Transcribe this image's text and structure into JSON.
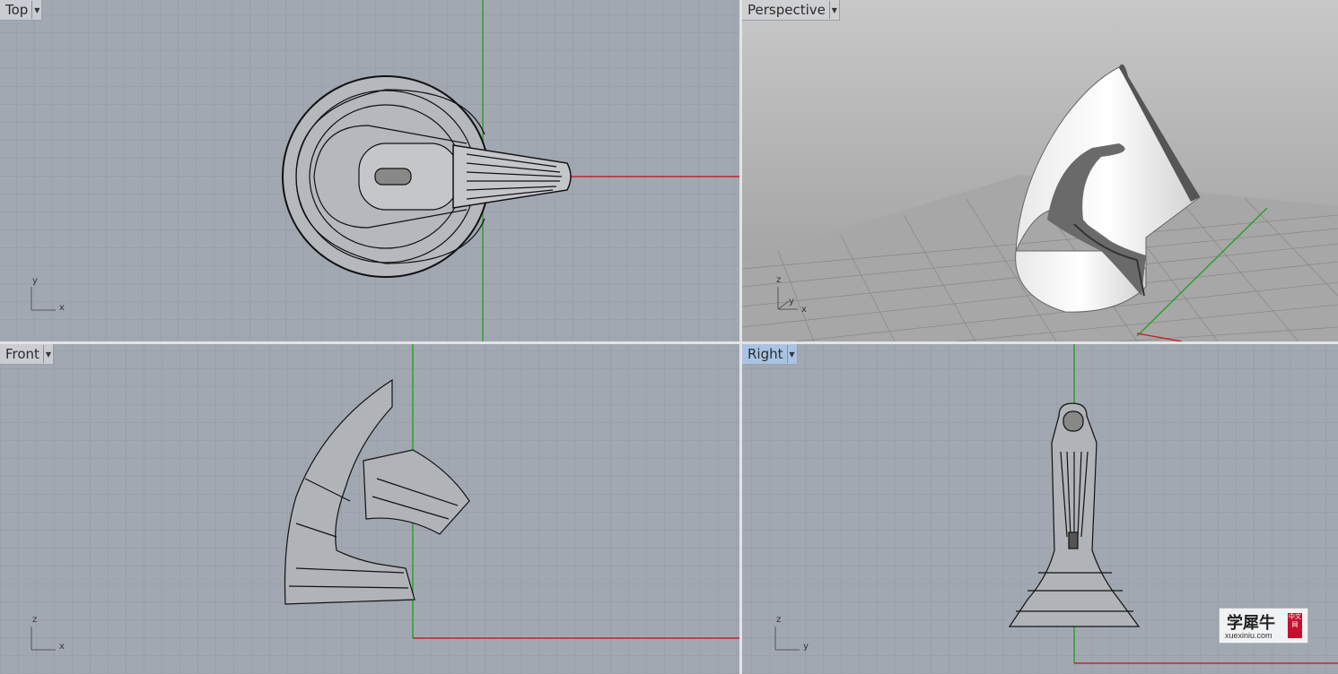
{
  "viewports": {
    "top": {
      "title": "Top",
      "axes": {
        "a": "y",
        "b": "x"
      }
    },
    "perspective": {
      "title": "Perspective",
      "axes": {
        "a": "z",
        "b": "y",
        "c": "x"
      }
    },
    "front": {
      "title": "Front",
      "axes": {
        "a": "z",
        "b": "x"
      }
    },
    "right": {
      "title": "Right",
      "axes": {
        "a": "z",
        "b": "y"
      }
    }
  },
  "watermark": {
    "main": "学犀牛",
    "site": "xuexiniu.com",
    "badge": "中文网"
  },
  "colors": {
    "viewport_bg": "#a2a8b2",
    "grid": "#8f96a0",
    "grid_major": "#7d838d",
    "x_axis": "#c0282d",
    "y_axis": "#2ca02c",
    "wire": "#111111"
  }
}
